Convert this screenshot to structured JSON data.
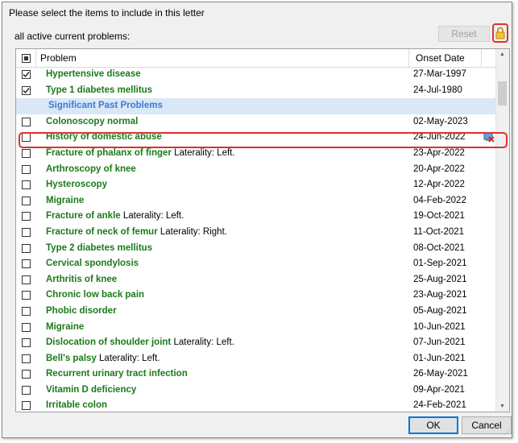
{
  "dialog": {
    "title": "Please select the items to include in this letter",
    "subtitle": "all active current problems:",
    "reset_label": "Reset",
    "ok_label": "OK",
    "cancel_label": "Cancel"
  },
  "table": {
    "columns": [
      "Problem",
      "Onset Date"
    ],
    "rows": [
      {
        "type": "item",
        "checked": true,
        "name": "Hypertensive disease",
        "laterality": "",
        "date": "27-Mar-1997"
      },
      {
        "type": "item",
        "checked": true,
        "name": "Type 1 diabetes mellitus",
        "laterality": "",
        "date": "24-Jul-1980"
      },
      {
        "type": "group",
        "name": "Significant Past Problems"
      },
      {
        "type": "item",
        "checked": false,
        "name": "Colonoscopy normal",
        "laterality": "",
        "date": "02-May-2023"
      },
      {
        "type": "item",
        "checked": false,
        "name": "History of domestic abuse",
        "laterality": "",
        "date": "24-Jun-2022",
        "icon": "confidential-icon"
      },
      {
        "type": "item",
        "checked": false,
        "name": "Fracture of phalanx of finger",
        "laterality": "Laterality: Left.",
        "date": "23-Apr-2022"
      },
      {
        "type": "item",
        "checked": false,
        "name": "Arthroscopy of knee",
        "laterality": "",
        "date": "20-Apr-2022"
      },
      {
        "type": "item",
        "checked": false,
        "name": "Hysteroscopy",
        "laterality": "",
        "date": "12-Apr-2022"
      },
      {
        "type": "item",
        "checked": false,
        "name": "Migraine",
        "laterality": "",
        "date": "04-Feb-2022"
      },
      {
        "type": "item",
        "checked": false,
        "name": "Fracture of ankle",
        "laterality": "Laterality: Left.",
        "date": "19-Oct-2021"
      },
      {
        "type": "item",
        "checked": false,
        "name": "Fracture of neck of femur",
        "laterality": "Laterality: Right.",
        "date": "11-Oct-2021"
      },
      {
        "type": "item",
        "checked": false,
        "name": "Type 2 diabetes mellitus",
        "laterality": "",
        "date": "08-Oct-2021"
      },
      {
        "type": "item",
        "checked": false,
        "name": "Cervical spondylosis",
        "laterality": "",
        "date": "01-Sep-2021"
      },
      {
        "type": "item",
        "checked": false,
        "name": "Arthritis of knee",
        "laterality": "",
        "date": "25-Aug-2021"
      },
      {
        "type": "item",
        "checked": false,
        "name": "Chronic low back pain",
        "laterality": "",
        "date": "23-Aug-2021"
      },
      {
        "type": "item",
        "checked": false,
        "name": "Phobic disorder",
        "laterality": "",
        "date": "05-Aug-2021"
      },
      {
        "type": "item",
        "checked": false,
        "name": "Migraine",
        "laterality": "",
        "date": "10-Jun-2021"
      },
      {
        "type": "item",
        "checked": false,
        "name": "Dislocation of shoulder joint",
        "laterality": "Laterality: Left.",
        "date": "07-Jun-2021"
      },
      {
        "type": "item",
        "checked": false,
        "name": "Bell's palsy",
        "laterality": "Laterality: Left.",
        "date": "01-Jun-2021"
      },
      {
        "type": "item",
        "checked": false,
        "name": "Recurrent urinary tract infection",
        "laterality": "",
        "date": "26-May-2021"
      },
      {
        "type": "item",
        "checked": false,
        "name": "Vitamin D deficiency",
        "laterality": "",
        "date": "09-Apr-2021"
      },
      {
        "type": "item",
        "checked": false,
        "name": "Irritable colon",
        "laterality": "",
        "date": "24-Feb-2021"
      }
    ]
  },
  "colors": {
    "problem_text": "#1a7a1a",
    "group_text": "#3a7bd5",
    "group_bg": "#d9e7f6",
    "highlight": "#e0302a"
  }
}
